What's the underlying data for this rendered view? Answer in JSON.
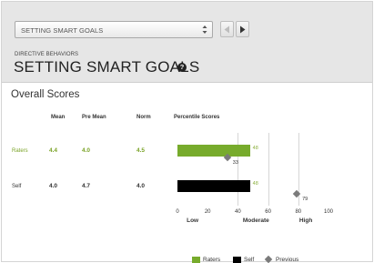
{
  "selector": {
    "value": "SETTING SMART GOALS"
  },
  "header": {
    "category": "DIRECTIVE BEHAVIORS",
    "title": "SETTING SMART GOALS",
    "help_symbol": "?"
  },
  "section": {
    "title": "Overall Scores"
  },
  "table": {
    "columns": {
      "mean": "Mean",
      "pre_mean": "Pre Mean",
      "norm": "Norm",
      "percentile": "Percentile Scores"
    },
    "rows": [
      {
        "label": "Raters",
        "mean": "4.4",
        "pre_mean": "4.0",
        "norm": "4.5"
      },
      {
        "label": "Self",
        "mean": "4.0",
        "pre_mean": "4.7",
        "norm": "4.0"
      }
    ]
  },
  "chart_data": {
    "type": "bar",
    "orientation": "horizontal",
    "categories": [
      "Raters",
      "Self"
    ],
    "series": [
      {
        "name": "Raters",
        "values": [
          48,
          null
        ]
      },
      {
        "name": "Self",
        "values": [
          null,
          48
        ]
      },
      {
        "name": "Previous",
        "values": [
          33,
          79
        ]
      }
    ],
    "bar_labels": [
      "48",
      "48"
    ],
    "previous_labels": [
      "33",
      "79"
    ],
    "xlim": [
      0,
      100
    ],
    "xticks": [
      "0",
      "20",
      "40",
      "60",
      "80",
      "100"
    ],
    "bands": [
      "Low",
      "Moderate",
      "High"
    ],
    "gridlines": [
      40,
      60,
      80
    ],
    "legend_position": "bottom-right",
    "colors": {
      "raters": "#77ab2c",
      "self": "#000000",
      "previous": "#7a7a7a"
    }
  },
  "legend": {
    "raters": "Raters",
    "self": "Self",
    "previous": "Previous"
  }
}
